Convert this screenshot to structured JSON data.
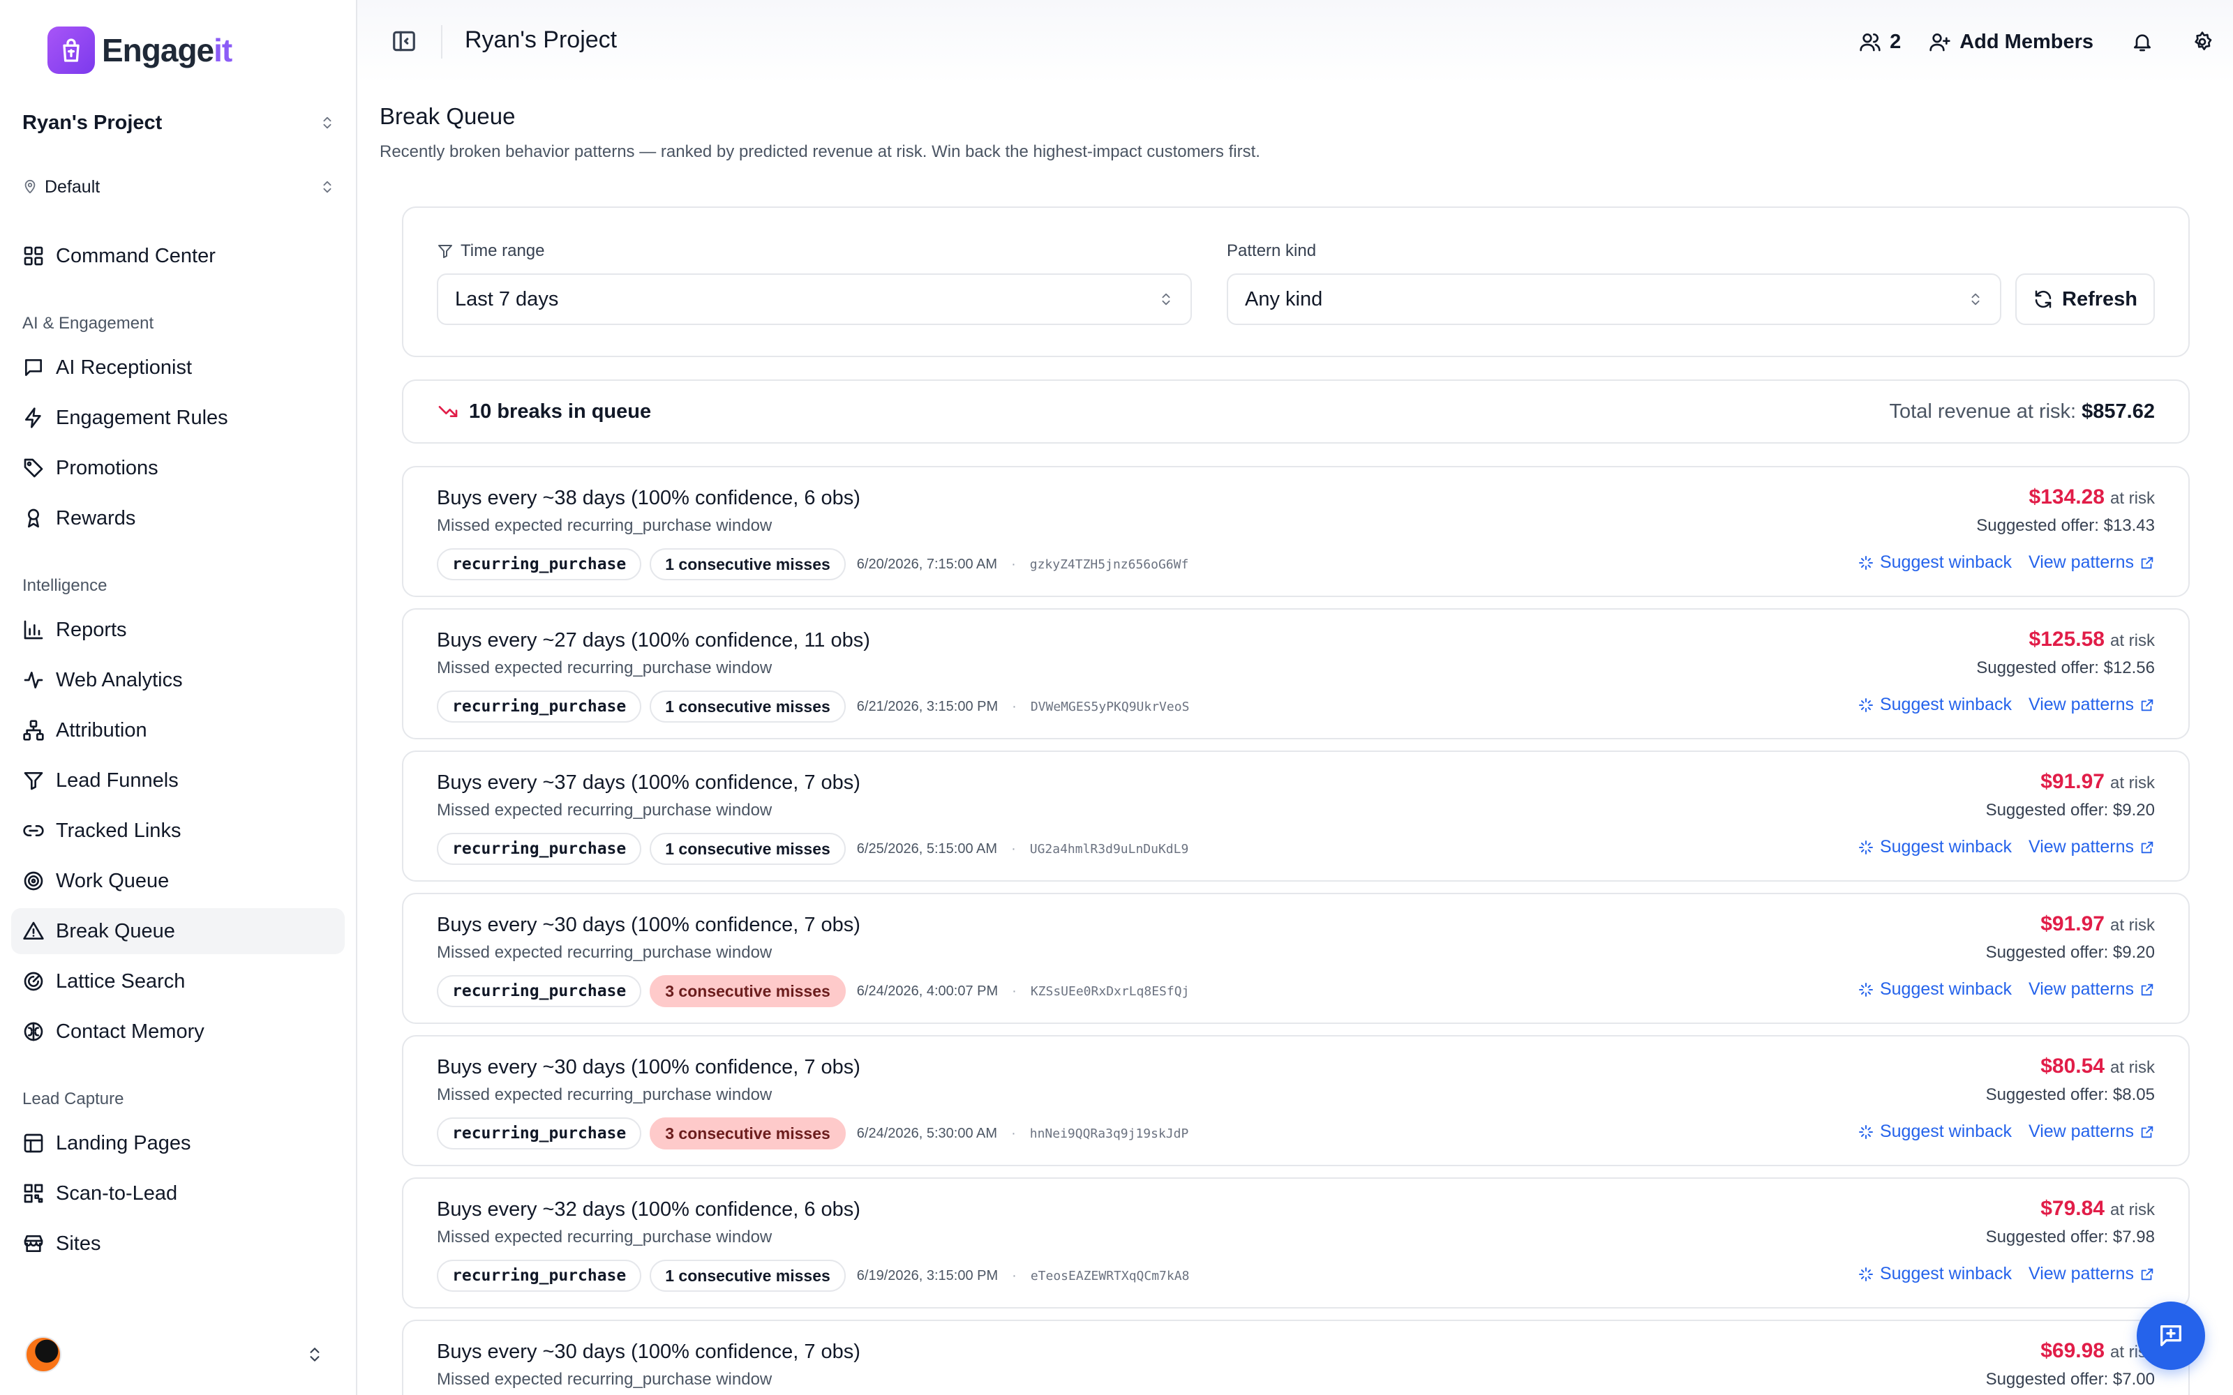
{
  "brand": {
    "name_main": "Engage",
    "name_accent": "it"
  },
  "sidebar": {
    "project": "Ryan's Project",
    "location": "Default",
    "items": [
      {
        "id": "command-center",
        "label": "Command Center",
        "icon": "grid-icon"
      },
      {
        "id": "ai-receptionist",
        "label": "AI Receptionist",
        "icon": "chat-icon"
      },
      {
        "id": "engagement-rules",
        "label": "Engagement Rules",
        "icon": "bolt-icon"
      },
      {
        "id": "promotions",
        "label": "Promotions",
        "icon": "tag-icon"
      },
      {
        "id": "rewards",
        "label": "Rewards",
        "icon": "ribbon-icon"
      },
      {
        "id": "reports",
        "label": "Reports",
        "icon": "bar-chart-icon"
      },
      {
        "id": "web-analytics",
        "label": "Web Analytics",
        "icon": "activity-icon"
      },
      {
        "id": "attribution",
        "label": "Attribution",
        "icon": "network-icon"
      },
      {
        "id": "lead-funnels",
        "label": "Lead Funnels",
        "icon": "funnel-icon"
      },
      {
        "id": "tracked-links",
        "label": "Tracked Links",
        "icon": "link-icon"
      },
      {
        "id": "work-queue",
        "label": "Work Queue",
        "icon": "target-icon"
      },
      {
        "id": "break-queue",
        "label": "Break Queue",
        "icon": "warning-icon"
      },
      {
        "id": "lattice-search",
        "label": "Lattice Search",
        "icon": "radar-icon"
      },
      {
        "id": "contact-memory",
        "label": "Contact Memory",
        "icon": "brain-icon"
      },
      {
        "id": "landing-pages",
        "label": "Landing Pages",
        "icon": "layout-icon"
      },
      {
        "id": "scan-to-lead",
        "label": "Scan-to-Lead",
        "icon": "qr-icon"
      },
      {
        "id": "sites",
        "label": "Sites",
        "icon": "store-icon"
      }
    ],
    "sections": {
      "ai_engagement": "AI & Engagement",
      "intelligence": "Intelligence",
      "lead_capture": "Lead Capture"
    }
  },
  "header": {
    "title": "Ryan's Project",
    "member_count": "2",
    "add_members": "Add Members"
  },
  "page": {
    "title": "Break Queue",
    "subtitle": "Recently broken behavior patterns — ranked by predicted revenue at risk. Win back the highest-impact customers first."
  },
  "filters": {
    "time_range_label": "Time range",
    "time_range_value": "Last 7 days",
    "pattern_kind_label": "Pattern kind",
    "pattern_kind_value": "Any kind",
    "refresh_label": "Refresh"
  },
  "summary": {
    "count_text": "10 breaks in queue",
    "total_label": "Total revenue at risk:",
    "total_value": "$857.62"
  },
  "labels": {
    "at_risk": "at risk",
    "suggest_winback": "Suggest winback",
    "view_patterns": "View patterns",
    "dot": "·"
  },
  "breaks": [
    {
      "title": "Buys every ~38 days (100% confidence, 6 obs)",
      "desc": "Missed expected recurring_purchase window",
      "kind": "recurring_purchase",
      "misses": "1 consecutive misses",
      "misses_level": 1,
      "time": "6/20/2026, 7:15:00 AM",
      "contact": "gzkyZ4TZH5jnz656oG6Wf",
      "amount": "$134.28",
      "offer": "Suggested offer: $13.43"
    },
    {
      "title": "Buys every ~27 days (100% confidence, 11 obs)",
      "desc": "Missed expected recurring_purchase window",
      "kind": "recurring_purchase",
      "misses": "1 consecutive misses",
      "misses_level": 1,
      "time": "6/21/2026, 3:15:00 PM",
      "contact": "DVWeMGES5yPKQ9UkrVeoS",
      "amount": "$125.58",
      "offer": "Suggested offer: $12.56"
    },
    {
      "title": "Buys every ~37 days (100% confidence, 7 obs)",
      "desc": "Missed expected recurring_purchase window",
      "kind": "recurring_purchase",
      "misses": "1 consecutive misses",
      "misses_level": 1,
      "time": "6/25/2026, 5:15:00 AM",
      "contact": "UG2a4hmlR3d9uLnDuKdL9",
      "amount": "$91.97",
      "offer": "Suggested offer: $9.20"
    },
    {
      "title": "Buys every ~30 days (100% confidence, 7 obs)",
      "desc": "Missed expected recurring_purchase window",
      "kind": "recurring_purchase",
      "misses": "3 consecutive misses",
      "misses_level": 3,
      "time": "6/24/2026, 4:00:07 PM",
      "contact": "KZSsUEe0RxDxrLq8ESfQj",
      "amount": "$91.97",
      "offer": "Suggested offer: $9.20"
    },
    {
      "title": "Buys every ~30 days (100% confidence, 7 obs)",
      "desc": "Missed expected recurring_purchase window",
      "kind": "recurring_purchase",
      "misses": "3 consecutive misses",
      "misses_level": 3,
      "time": "6/24/2026, 5:30:00 AM",
      "contact": "hnNei9QQRa3q9j19skJdP",
      "amount": "$80.54",
      "offer": "Suggested offer: $8.05"
    },
    {
      "title": "Buys every ~32 days (100% confidence, 6 obs)",
      "desc": "Missed expected recurring_purchase window",
      "kind": "recurring_purchase",
      "misses": "1 consecutive misses",
      "misses_level": 1,
      "time": "6/19/2026, 3:15:00 PM",
      "contact": "eTeosEAZEWRTXqQCm7kA8",
      "amount": "$79.84",
      "offer": "Suggested offer: $7.98"
    },
    {
      "title": "Buys every ~30 days (100% confidence, 7 obs)",
      "desc": "Missed expected recurring_purchase window",
      "kind": "recurring_purchase",
      "misses": "",
      "misses_level": 1,
      "time": "",
      "contact": "",
      "amount": "$69.98",
      "offer": "Suggested offer: $7.00"
    }
  ],
  "colors": {
    "accent": "#8b5cf6",
    "link": "#2563eb",
    "risk": "#e11d48",
    "danger_tag": "#fecaca"
  }
}
